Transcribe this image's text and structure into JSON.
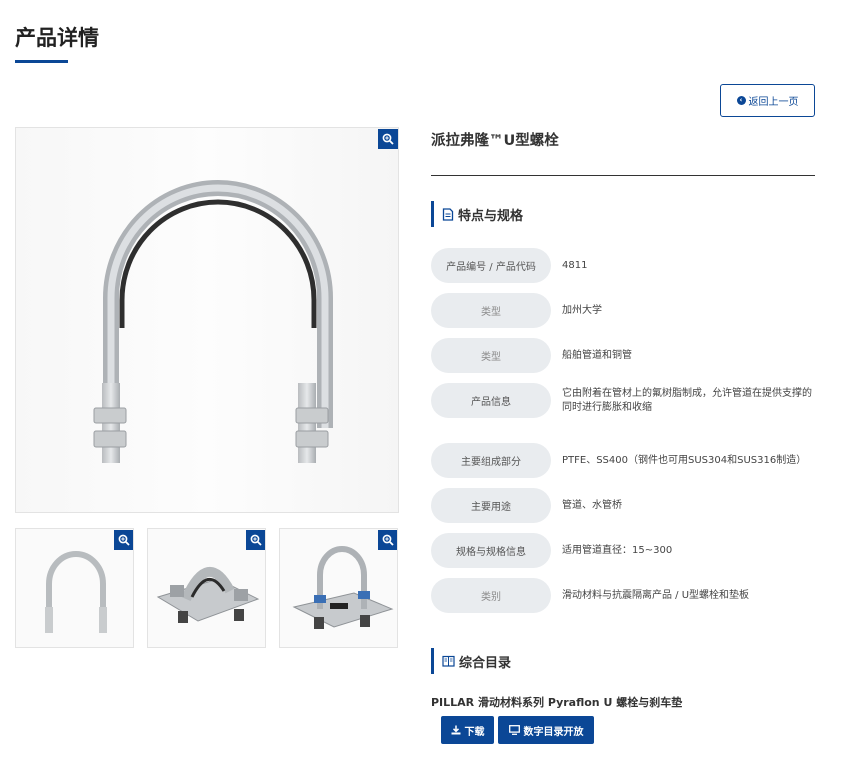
{
  "page": {
    "title": "产品详情"
  },
  "back_button": {
    "label": "返回上一页"
  },
  "product": {
    "name": "派拉弗隆™U型螺栓"
  },
  "features": {
    "heading": "特点与规格",
    "rows": [
      {
        "label": "产品编号 / 产品代码",
        "value": "4811"
      },
      {
        "label": "类型",
        "value": "加州大学"
      },
      {
        "label": "类型",
        "value": "船舶管道和铜管"
      },
      {
        "label": "产品信息",
        "value": "它由附着在管材上的氟树脂制成，允许管道在提供支撑的同时进行膨胀和收缩"
      },
      {
        "label": "主要组成部分",
        "value": "PTFE、SS400（钢件也可用SUS304和SUS316制造）"
      },
      {
        "label": "主要用途",
        "value": "管道、水管桥"
      },
      {
        "label": "规格与规格信息",
        "value": "适用管道直径：15~300"
      },
      {
        "label": "类别",
        "value": "滑动材料与抗震隔离产品 / U型螺栓和垫板"
      }
    ]
  },
  "catalog": {
    "heading": "综合目录",
    "title": "PILLAR 滑动材料系列 Pyraflon U 螺栓与刹车垫",
    "download_label": "下载",
    "open_label": "数字目录开放"
  },
  "icons": {
    "zoom": "zoom-in-icon",
    "back": "arrow-left-circle-icon",
    "document": "document-icon",
    "catalog": "book-icon",
    "download": "download-icon",
    "monitor": "monitor-icon"
  },
  "colors": {
    "accent": "#0b4796",
    "label_bg": "#e9ecef"
  }
}
